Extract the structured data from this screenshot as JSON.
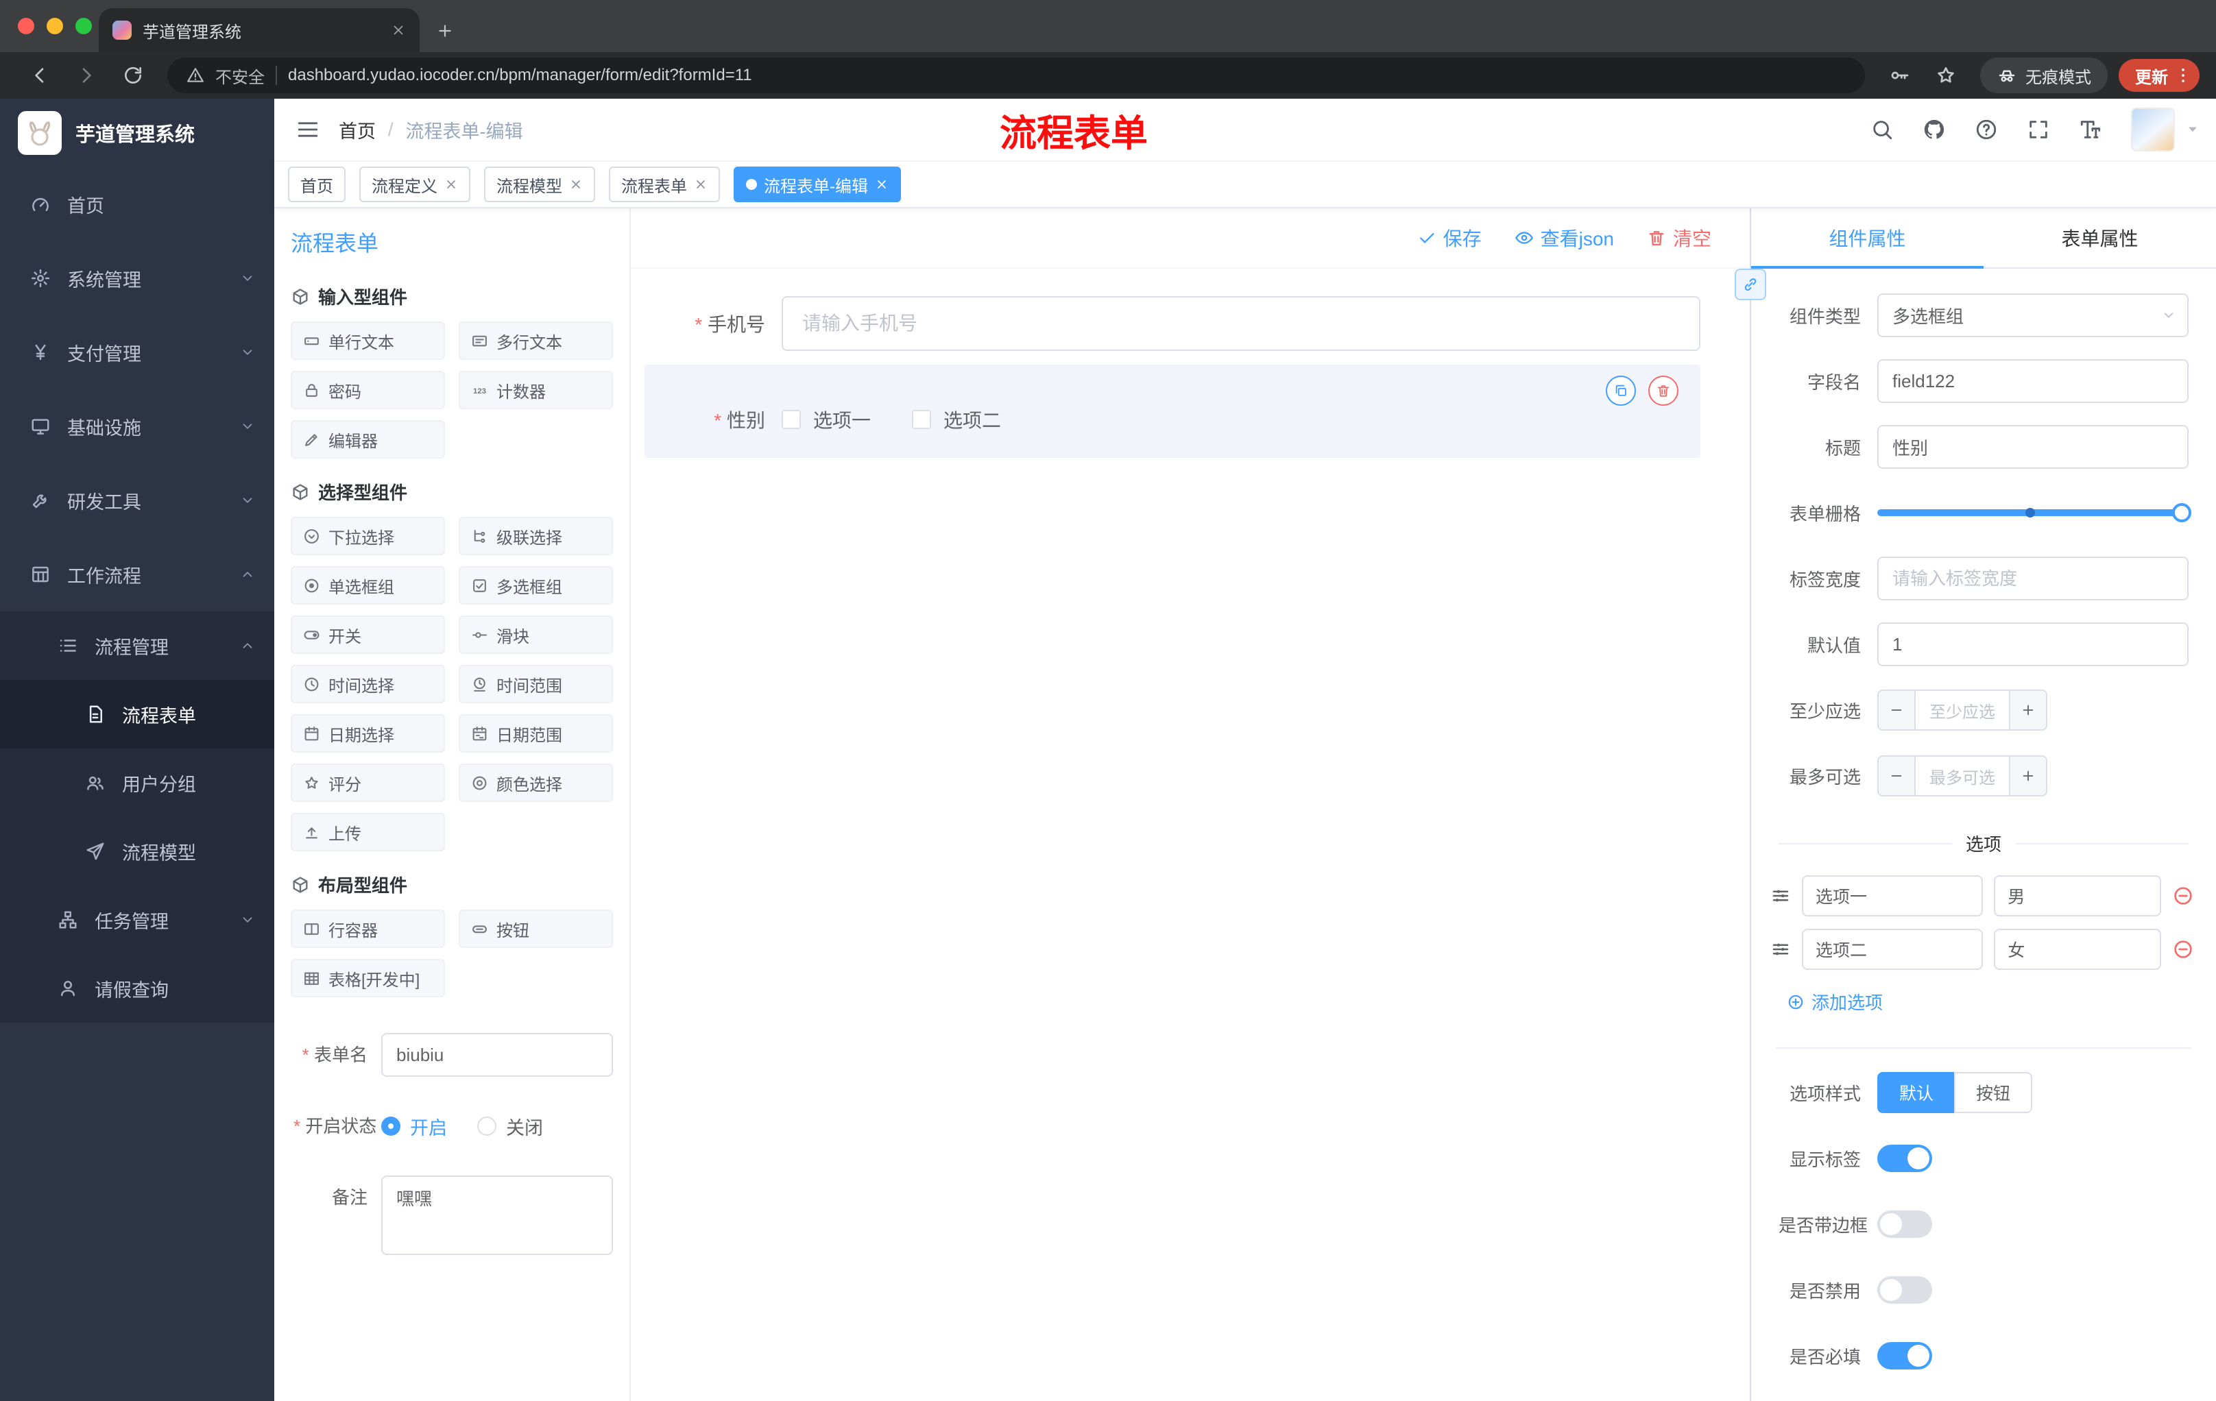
{
  "theme": {
    "accent": "#409eff",
    "danger": "#f56c6c",
    "sidebar_bg": "#2d3445",
    "active_tag_bg": "#409eff",
    "annotation_color": "#fb0e0e"
  },
  "browser": {
    "tab_title": "芋道管理系统",
    "security": "不安全",
    "url": "dashboard.yudao.iocoder.cn/bpm/manager/form/edit?formId=11",
    "incognito": "无痕模式",
    "update": "更新"
  },
  "sidebar": {
    "app_title": "芋道管理系统",
    "items": [
      {
        "label": "首页",
        "icon": "gauge"
      },
      {
        "label": "系统管理",
        "icon": "gear",
        "chevron": "chevron-down"
      },
      {
        "label": "支付管理",
        "icon": "yen",
        "chevron": "chevron-down"
      },
      {
        "label": "基础设施",
        "icon": "monitor",
        "chevron": "chevron-down"
      },
      {
        "label": "研发工具",
        "icon": "tools",
        "chevron": "chevron-down"
      },
      {
        "label": "工作流程",
        "icon": "workflow",
        "chevron": "chevron-up"
      },
      {
        "label": "流程管理",
        "icon": "list",
        "chevron": "chevron-up"
      },
      {
        "label": "流程表单",
        "icon": "document"
      },
      {
        "label": "用户分组",
        "icon": "users"
      },
      {
        "label": "流程模型",
        "icon": "send"
      },
      {
        "label": "任务管理",
        "icon": "tree",
        "chevron": "chevron-down"
      },
      {
        "label": "请假查询",
        "icon": "person"
      }
    ]
  },
  "header": {
    "breadcrumb_root": "首页",
    "breadcrumb_sep": "/",
    "breadcrumb_current": "流程表单-编辑",
    "annotation": "流程表单"
  },
  "tags": [
    {
      "label": "首页"
    },
    {
      "label": "流程定义"
    },
    {
      "label": "流程模型"
    },
    {
      "label": "流程表单"
    },
    {
      "label": "流程表单-编辑"
    }
  ],
  "palette": {
    "title": "流程表单",
    "groups": [
      {
        "title": "输入型组件",
        "items": [
          {
            "label": "单行文本",
            "icon": "input"
          },
          {
            "label": "多行文本",
            "icon": "textarea"
          },
          {
            "label": "密码",
            "icon": "lock"
          },
          {
            "label": "计数器",
            "icon": "counter"
          },
          {
            "label": "编辑器",
            "icon": "editor"
          }
        ]
      },
      {
        "title": "选择型组件",
        "items": [
          {
            "label": "下拉选择",
            "icon": "select"
          },
          {
            "label": "级联选择",
            "icon": "cascader"
          },
          {
            "label": "单选框组",
            "icon": "radio"
          },
          {
            "label": "多选框组",
            "icon": "checkbox"
          },
          {
            "label": "开关",
            "icon": "switch"
          },
          {
            "label": "滑块",
            "icon": "slider"
          },
          {
            "label": "时间选择",
            "icon": "time"
          },
          {
            "label": "时间范围",
            "icon": "time-range"
          },
          {
            "label": "日期选择",
            "icon": "date"
          },
          {
            "label": "日期范围",
            "icon": "date-range"
          },
          {
            "label": "评分",
            "icon": "rate"
          },
          {
            "label": "颜色选择",
            "icon": "color"
          },
          {
            "label": "上传",
            "icon": "upload"
          }
        ]
      },
      {
        "title": "布局型组件",
        "items": [
          {
            "label": "行容器",
            "icon": "row"
          },
          {
            "label": "按钮",
            "icon": "button"
          },
          {
            "label": "表格[开发中]",
            "icon": "table"
          }
        ]
      }
    ],
    "meta": {
      "name_label": "表单名",
      "name_value": "biubiu",
      "status_label": "开启状态",
      "status_on": "开启",
      "status_off": "关闭",
      "remark_label": "备注",
      "remark_value": "嘿嘿"
    }
  },
  "canvas": {
    "save": "保存",
    "view_json": "查看json",
    "clear": "清空",
    "phone_label": "手机号",
    "phone_placeholder": "请输入手机号",
    "gender_label": "性别",
    "gender_opt1": "选项一",
    "gender_opt2": "选项二"
  },
  "props": {
    "tab_component": "组件属性",
    "tab_form": "表单属性",
    "rows": {
      "type_label": "组件类型",
      "type_value": "多选框组",
      "field_label": "字段名",
      "field_value": "field122",
      "title_label": "标题",
      "title_value": "性别",
      "grid_label": "表单栅格",
      "width_label": "标签宽度",
      "width_placeholder": "请输入标签宽度",
      "default_label": "默认值",
      "default_value": "1",
      "min_label": "至少应选",
      "min_placeholder": "至少应选",
      "max_label": "最多可选",
      "max_placeholder": "最多可选"
    },
    "options": {
      "divider": "选项",
      "row1_name": "选项一",
      "row1_value": "男",
      "row2_name": "选项二",
      "row2_value": "女",
      "add": "添加选项"
    },
    "style": {
      "label": "选项样式",
      "default_btn": "默认",
      "button_btn": "按钮"
    },
    "toggles": {
      "show_label": "显示标签",
      "border_label": "是否带边框",
      "disabled_label": "是否禁用",
      "required_label": "是否必填"
    }
  }
}
